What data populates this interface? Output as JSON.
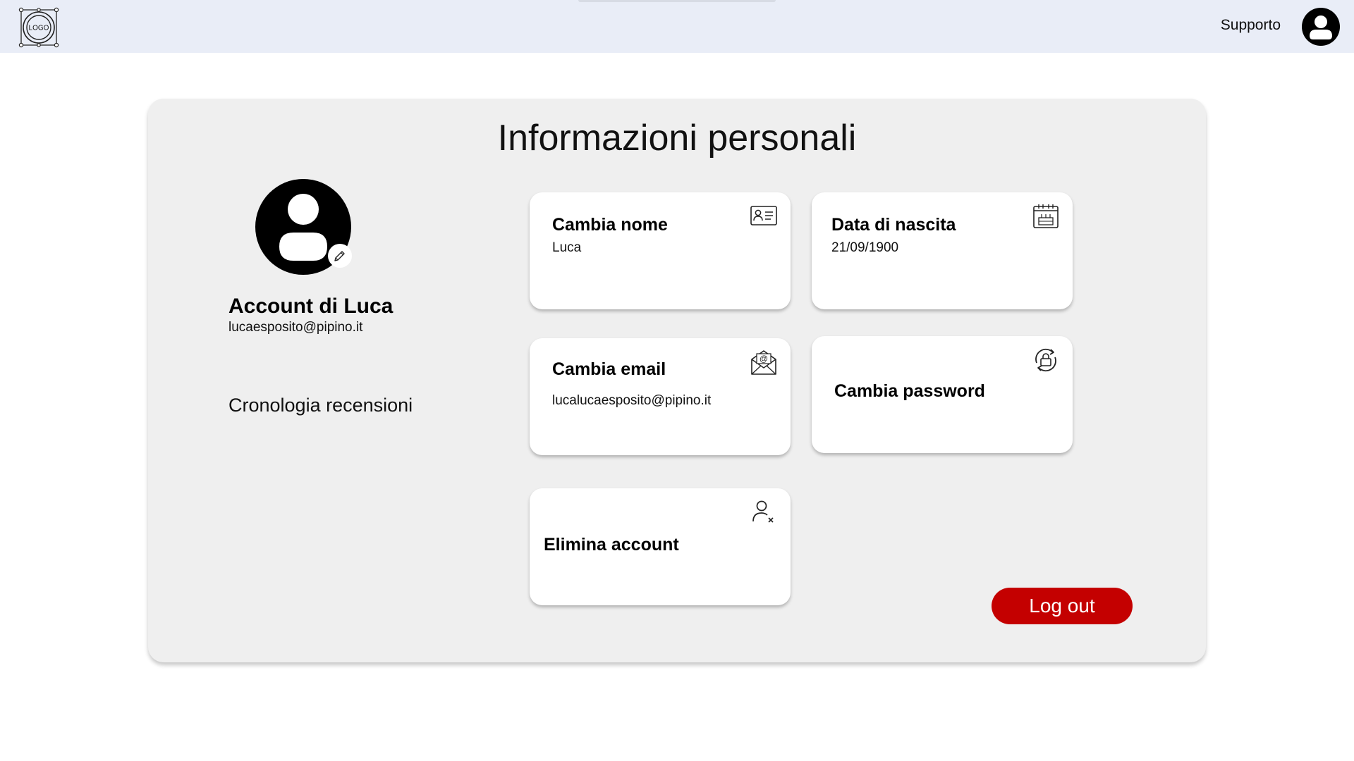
{
  "header": {
    "logo_text": "LOGO",
    "support_label": "Supporto"
  },
  "page": {
    "title": "Informazioni personali"
  },
  "profile": {
    "account_name": "Account di Luca",
    "email": "lucaesposito@pipino.it",
    "reviews_link": "Cronologia recensioni"
  },
  "cards": {
    "name": {
      "title": "Cambia nome",
      "value": "Luca",
      "icon": "id-card-icon"
    },
    "birth": {
      "title": "Data di nascita",
      "value": "21/09/1900",
      "icon": "birthday-cake-calendar-icon"
    },
    "email": {
      "title": "Cambia email",
      "value": "lucalucaesposito@pipino.it",
      "icon": "envelope-at-icon"
    },
    "password": {
      "title": "Cambia password",
      "icon": "lock-refresh-icon"
    },
    "delete": {
      "title": "Elimina account",
      "icon": "user-remove-icon"
    }
  },
  "actions": {
    "logout_label": "Log out"
  },
  "colors": {
    "topbar": "#e9edf7",
    "panel": "#efefef",
    "logout": "#c40000"
  }
}
